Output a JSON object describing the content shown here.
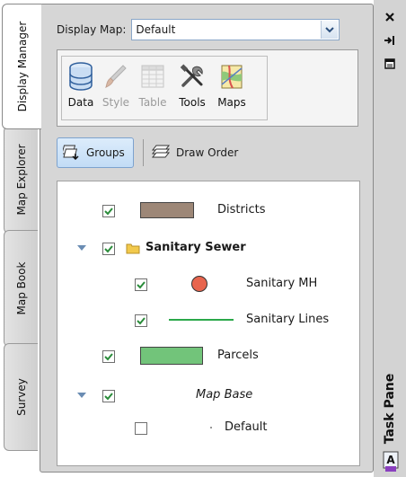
{
  "side_tabs": [
    {
      "label": "Display Manager"
    },
    {
      "label": "Map Explorer"
    },
    {
      "label": "Map Book"
    },
    {
      "label": "Survey"
    }
  ],
  "display_map": {
    "label": "Display Map:",
    "value": "Default"
  },
  "tools": [
    {
      "label": "Data",
      "icon": "database-icon",
      "enabled": true
    },
    {
      "label": "Style",
      "icon": "brush-icon",
      "enabled": false
    },
    {
      "label": "Table",
      "icon": "table-icon",
      "enabled": false
    },
    {
      "label": "Tools",
      "icon": "tools-icon",
      "enabled": true
    },
    {
      "label": "Maps",
      "icon": "maps-icon",
      "enabled": true
    }
  ],
  "view_buttons": {
    "groups": "Groups",
    "draw_order": "Draw Order"
  },
  "layers": [
    {
      "name": "Districts",
      "checked": true,
      "symbol": "rect",
      "color": "#9d8777"
    },
    {
      "name": "Sanitary Sewer",
      "checked": true,
      "group": true
    },
    {
      "name": "Sanitary MH",
      "checked": true,
      "symbol": "circle",
      "color": "#e8654e"
    },
    {
      "name": "Sanitary Lines",
      "checked": true,
      "symbol": "line",
      "color": "#2aa84a"
    },
    {
      "name": "Parcels",
      "checked": true,
      "symbol": "rect",
      "color": "#72c47a"
    },
    {
      "name": "Map Base",
      "checked": true,
      "group": true
    },
    {
      "name": "Default",
      "checked": false
    }
  ],
  "right_strip": {
    "title": "Task Pane",
    "close_icon": "close-icon",
    "autohide_icon": "pin-icon",
    "properties_icon": "properties-icon"
  }
}
